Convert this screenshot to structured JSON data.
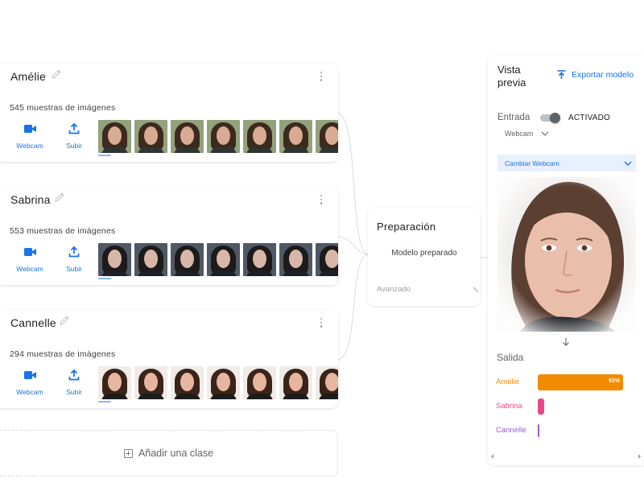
{
  "classes": [
    {
      "name": "Amélie",
      "samples": "545 muestras de imágenes",
      "webcam_label": "Webcam",
      "upload_label": "Subir",
      "thumbs": {
        "bg": "#93a27c",
        "hair": "#3d2a1f",
        "face": "#d8ab94",
        "shirt": "#2e3532"
      }
    },
    {
      "name": "Sabrina",
      "samples": "553 muestras de imágenes",
      "webcam_label": "Webcam",
      "upload_label": "Subir",
      "thumbs": {
        "bg": "#505866",
        "hair": "#1c1a1a",
        "face": "#d7b7a8",
        "shirt": "#1d2026"
      }
    },
    {
      "name": "Cannelle",
      "samples": "294 muestras de imágenes",
      "webcam_label": "Webcam",
      "upload_label": "Subir",
      "thumbs": {
        "bg": "#f0ebe7",
        "hair": "#3a2419",
        "face": "#e7b6a1",
        "shirt": "#1c1c1c"
      }
    }
  ],
  "add_class": {
    "label": "Añadir una clase"
  },
  "training": {
    "title": "Preparación",
    "status": "Modelo preparado",
    "advanced": "Avanzado"
  },
  "preview": {
    "title": "Vista previa",
    "export": "Exportar modelo",
    "input_label": "Entrada",
    "toggle_state": "ACTIVADO",
    "camera": "Webcam",
    "switch_camera": "Cambiar Webcam",
    "output_label": "Salida",
    "results": [
      {
        "name": "Amélie",
        "percent": 93,
        "label": "93%",
        "color": "#f28b00"
      },
      {
        "name": "Sabrina",
        "percent": 6,
        "label": "",
        "color": "#e8488a"
      },
      {
        "name": "Cannelle",
        "percent": 1,
        "label": "",
        "color": "#9b59d0"
      }
    ]
  },
  "icons": {
    "pencil": "edit-pencil-icon",
    "kebab": "more-vert-icon",
    "webcam": "videocam-icon",
    "upload": "upload-icon",
    "export": "export-upload-icon",
    "chevron": "chevron-down-icon",
    "arrow": "arrow-down-icon"
  }
}
